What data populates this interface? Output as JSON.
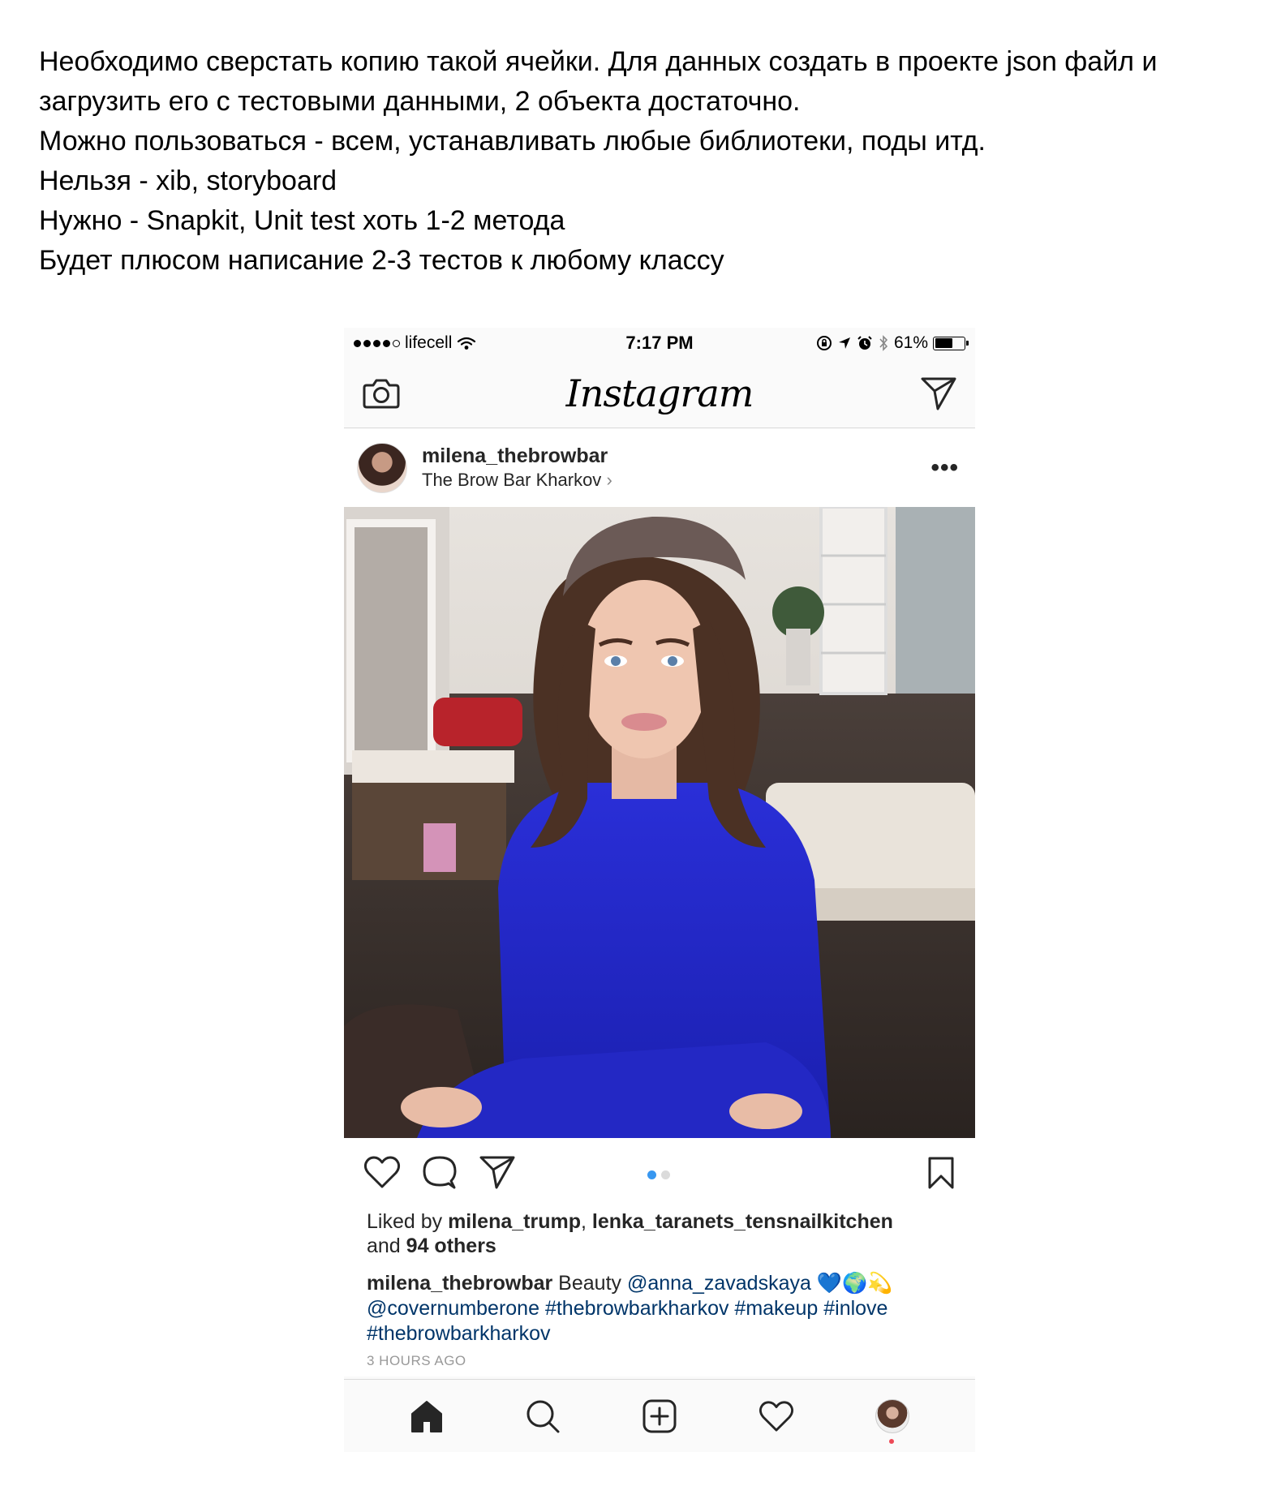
{
  "task": {
    "lines": [
      "Необходимо сверстать копию такой ячейки. Для данных создать в проекте json файл и",
      "загрузить его с тестовыми данными, 2 объекта достаточно.",
      "Можно пользоваться - всем, устанавливать любые библиотеки, поды итд.",
      "Нельзя - xib, storyboard",
      "Нужно - Snapkit, Unit test хоть 1-2 метода",
      "Будет плюсом написание 2-3 тестов к любому классу"
    ]
  },
  "status_bar": {
    "carrier": "lifecell",
    "time": "7:17 PM",
    "battery": "61%",
    "battery_level": 0.61
  },
  "nav": {
    "brand": "Instagram",
    "left_icon": "camera-icon",
    "right_icon": "direct-send-icon"
  },
  "post": {
    "username": "milena_thebrowbar",
    "location": "The Brow Bar Kharkov",
    "location_chevron": "›",
    "more": "•••",
    "carousel": {
      "count": 2,
      "active": 0
    },
    "likes": {
      "prefix": "Liked by ",
      "user1": "milena_trump",
      "sep": ", ",
      "user2": "lenka_taranets_tensnailkitchen",
      "and": "and ",
      "others": "94 others"
    },
    "caption": {
      "author": "milena_thebrowbar",
      "text": " Beauty ",
      "mention1": "@anna_zavadskaya",
      "emojis": " 💙🌍💫",
      "mention2": "@covernumberone",
      "tag1": "#thebrowbarkharkov",
      "tag2": "#makeup",
      "tag3": "#inlove",
      "tag4": "#thebrowbarkharkov"
    },
    "time_ago": "3 HOURS AGO"
  },
  "tab_bar": {
    "items": [
      "home-icon",
      "search-icon",
      "new-post-icon",
      "activity-icon",
      "profile-avatar"
    ]
  },
  "colors": {
    "link": "#003569",
    "active_dot": "#3897f0",
    "notification": "#ed4956"
  }
}
